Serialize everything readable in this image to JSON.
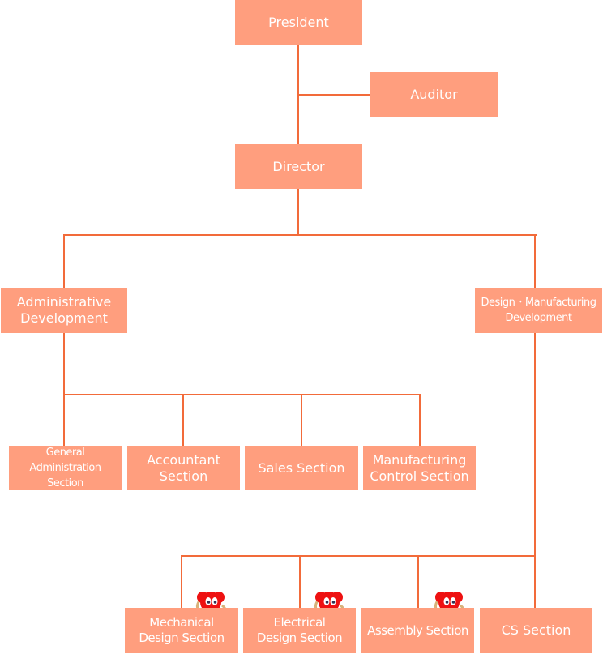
{
  "nodes": {
    "president": "President",
    "auditor": "Auditor",
    "director": "Director",
    "admin_dev": "Administrative Development",
    "design_mfg_dev": "Design・Manufacturing Development",
    "general_admin": "General Administration Section",
    "accountant": "Accountant Section",
    "sales": "Sales Section",
    "mfg_control": "Manufacturing Control Section",
    "mech_design": "Mechanical Design Section",
    "elec_design": "Electrical Design Section",
    "assembly": "Assembly Section",
    "cs": "CS Section"
  },
  "colors": {
    "box": "#FF9E7E",
    "line": "#F26B3A",
    "mascot": "#EE1111"
  },
  "icons": {
    "mascot": "red-mascot-character"
  }
}
